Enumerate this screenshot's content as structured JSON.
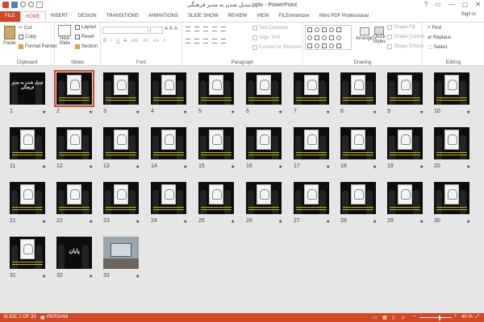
{
  "window": {
    "title": "تبدیل شدن به مدیر فرهنگی.pptx - PowerPoint",
    "controls": [
      "?",
      "▭",
      "—",
      "▢",
      "✕"
    ]
  },
  "tabs": [
    {
      "label": "FILE"
    },
    {
      "label": "HOME"
    },
    {
      "label": "INSERT"
    },
    {
      "label": "DESIGN"
    },
    {
      "label": "TRANSITIONS"
    },
    {
      "label": "ANIMATIONS"
    },
    {
      "label": "SLIDE SHOW"
    },
    {
      "label": "REVIEW"
    },
    {
      "label": "VIEW"
    },
    {
      "label": "FILEminimizer"
    },
    {
      "label": "Nitro PDF Professional"
    }
  ],
  "signin": "Sign in",
  "ribbon": {
    "clipboard": {
      "paste": "Paste",
      "cut": "Cut",
      "copy": "Copy",
      "format_painter": "Format Painter",
      "label": "Clipboard"
    },
    "slides": {
      "new_slide": "New",
      "new_slide2": "Slide",
      "layout": "Layout",
      "reset": "Reset",
      "section": "Section",
      "label": "Slides"
    },
    "font": {
      "label": "Font",
      "size_up": "A",
      "size_down": "A",
      "clear": "A",
      "bold": "B",
      "italic": "I",
      "underline": "U",
      "strike": "S",
      "shadow": "abc",
      "spacing": "AV",
      "case": "Aa",
      "color": "A"
    },
    "paragraph": {
      "text_direction": "Text Direction",
      "align_text": "Align Text",
      "convert": "Convert to SmartArt",
      "label": "Paragraph"
    },
    "drawing": {
      "arrange": "Arrange",
      "quick_styles": "Quick",
      "quick_styles2": "Styles",
      "shape_fill": "Shape Fill",
      "shape_outline": "Shape Outline",
      "shape_effects": "Shape Effects",
      "label": "Drawing"
    },
    "editing": {
      "find": "Find",
      "replace": "Replace",
      "select": "Select",
      "label": "Editing"
    }
  },
  "slides": {
    "selected": 2,
    "items": [
      {
        "num": "1",
        "title": "تبدیل شدن به مدیر فرهنگی"
      },
      {
        "num": "2"
      },
      {
        "num": "3"
      },
      {
        "num": "4"
      },
      {
        "num": "5"
      },
      {
        "num": "6"
      },
      {
        "num": "7"
      },
      {
        "num": "8"
      },
      {
        "num": "9"
      },
      {
        "num": "10"
      },
      {
        "num": "11"
      },
      {
        "num": "12"
      },
      {
        "num": "13"
      },
      {
        "num": "14"
      },
      {
        "num": "15"
      },
      {
        "num": "16"
      },
      {
        "num": "17"
      },
      {
        "num": "18"
      },
      {
        "num": "19"
      },
      {
        "num": "20"
      },
      {
        "num": "21"
      },
      {
        "num": "22"
      },
      {
        "num": "23"
      },
      {
        "num": "24"
      },
      {
        "num": "25"
      },
      {
        "num": "26"
      },
      {
        "num": "27"
      },
      {
        "num": "28"
      },
      {
        "num": "29"
      },
      {
        "num": "30"
      },
      {
        "num": "31"
      },
      {
        "num": "32",
        "title": "پایان"
      },
      {
        "num": "33"
      }
    ],
    "star": "★"
  },
  "status": {
    "slide_info": "SLIDE 2 OF 33",
    "language": "PERSIAN",
    "zoom_minus": "−",
    "zoom_plus": "+",
    "zoom": "40 %",
    "zoom_percent": 40
  },
  "colors": {
    "accent": "#d24726",
    "sorter_bg": "#e6e6e6"
  }
}
